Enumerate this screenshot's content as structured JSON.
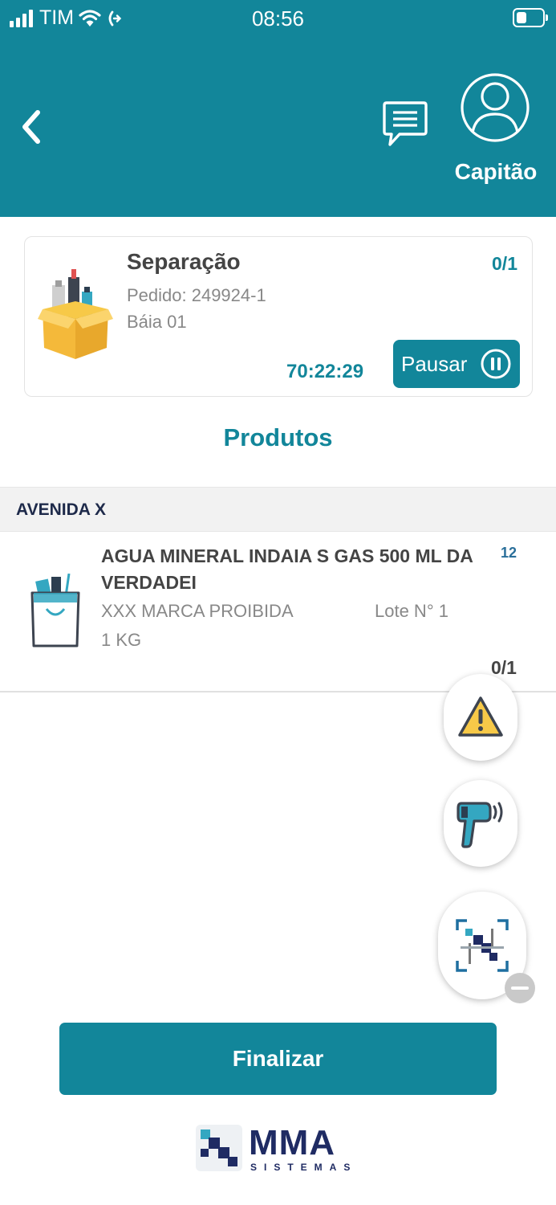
{
  "status_bar": {
    "carrier": "TIM",
    "time": "08:56"
  },
  "header": {
    "user_name": "Capitão"
  },
  "task": {
    "title": "Separação",
    "order": "Pedido: 249924-1",
    "bay": "Báia 01",
    "progress": "0/1",
    "timer": "70:22:29",
    "pause_label": "Pausar"
  },
  "products": {
    "section_title": "Produtos",
    "group_label": "AVENIDA X",
    "items": [
      {
        "name": "AGUA MINERAL INDAIA S GAS 500 ML DA VERDADEI",
        "quantity": "12",
        "brand": "XXX MARCA PROIBIDA",
        "lot": "Lote N° 1",
        "weight": "1 KG",
        "count": "0/1"
      }
    ]
  },
  "actions": {
    "finish_label": "Finalizar"
  },
  "branding": {
    "logo_name": "MMA",
    "logo_sub": "SISTEMAS"
  },
  "colors": {
    "primary": "#12869a",
    "logo": "#1f2b63"
  }
}
